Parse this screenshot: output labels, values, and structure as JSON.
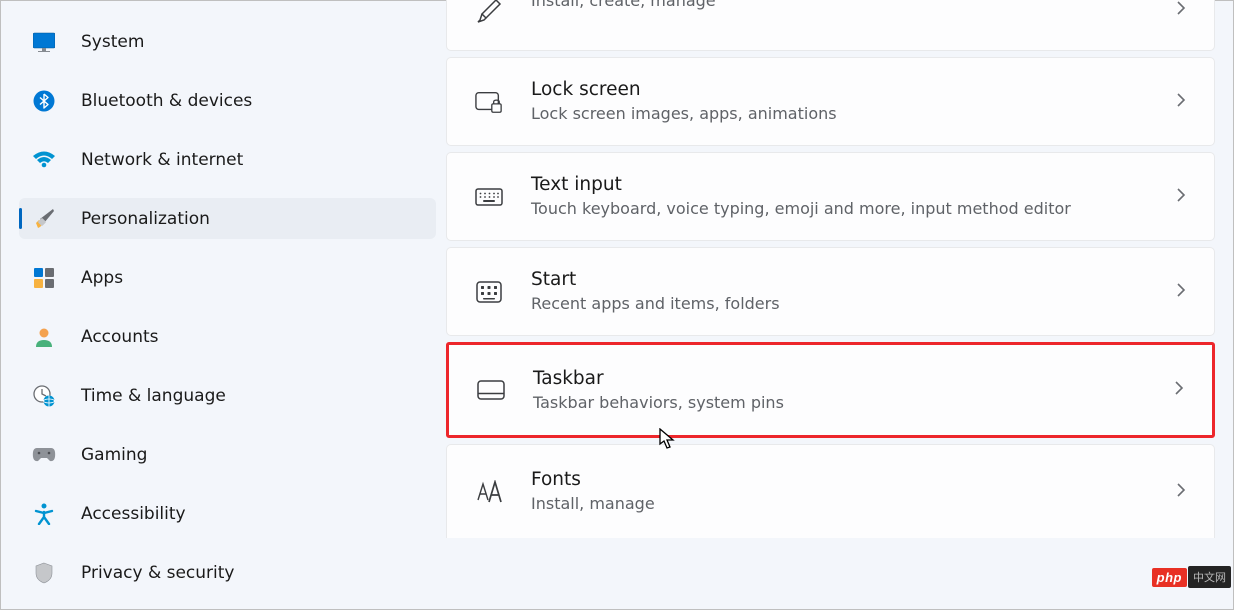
{
  "sidebar": {
    "items": [
      {
        "label": "System"
      },
      {
        "label": "Bluetooth & devices"
      },
      {
        "label": "Network & internet"
      },
      {
        "label": "Personalization"
      },
      {
        "label": "Apps"
      },
      {
        "label": "Accounts"
      },
      {
        "label": "Time & language"
      },
      {
        "label": "Gaming"
      },
      {
        "label": "Accessibility"
      },
      {
        "label": "Privacy & security"
      }
    ]
  },
  "cards": {
    "themes": {
      "sub": "Install, create, manage"
    },
    "lockscreen": {
      "title": "Lock screen",
      "sub": "Lock screen images, apps, animations"
    },
    "textinput": {
      "title": "Text input",
      "sub": "Touch keyboard, voice typing, emoji and more, input method editor"
    },
    "start": {
      "title": "Start",
      "sub": "Recent apps and items, folders"
    },
    "taskbar": {
      "title": "Taskbar",
      "sub": "Taskbar behaviors, system pins"
    },
    "fonts": {
      "title": "Fonts",
      "sub": "Install, manage"
    }
  },
  "badge": {
    "php": "php",
    "cn": "中文网"
  }
}
